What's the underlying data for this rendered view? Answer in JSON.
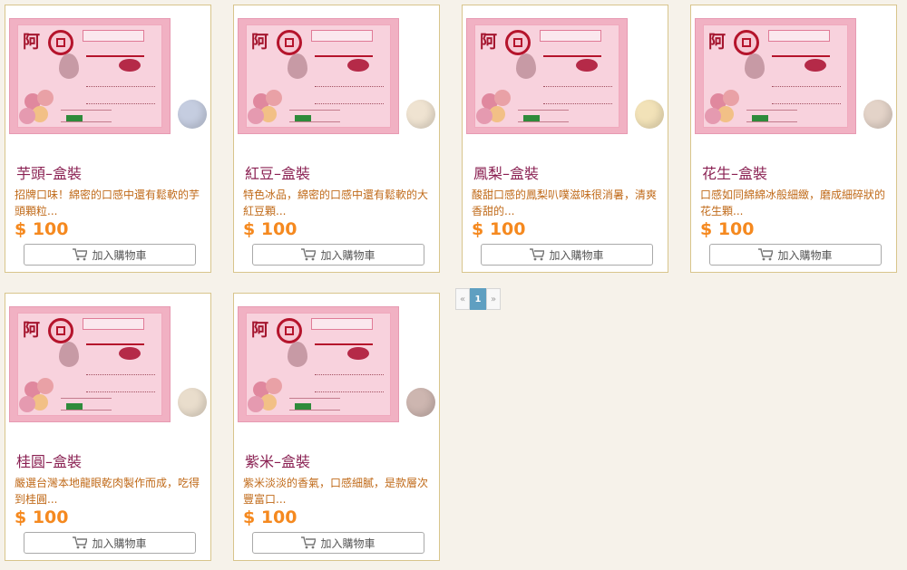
{
  "products": [
    {
      "title": "芋頭–盒裝",
      "desc": "招牌口味！綿密的口感中還有鬆軟的芋頭顆粒...",
      "price": "$ 100",
      "button": "加入購物車",
      "ball_color": "#c5cde0"
    },
    {
      "title": "紅豆–盒裝",
      "desc": "特色冰品，綿密的口感中還有鬆軟的大紅豆顆...",
      "price": "$ 100",
      "button": "加入購物車",
      "ball_color": "#efe3d1"
    },
    {
      "title": "鳳梨–盒裝",
      "desc": "酸甜口感的鳳梨叭噗滋味很消暑，清爽香甜的...",
      "price": "$ 100",
      "button": "加入購物車",
      "ball_color": "#f2e2b8"
    },
    {
      "title": "花生–盒裝",
      "desc": "口感如同綿綿冰般細緻，磨成細碎狀的花生顆...",
      "price": "$ 100",
      "button": "加入購物車",
      "ball_color": "#e3d3c8"
    },
    {
      "title": "桂圓–盒裝",
      "desc": "嚴選台灣本地龍眼乾肉製作而成，吃得到桂圓...",
      "price": "$ 100",
      "button": "加入購物車",
      "ball_color": "#e9ddcc"
    },
    {
      "title": "紫米–盒裝",
      "desc": "紫米淡淡的香氣，口感細膩，是款層次豐富口...",
      "price": "$ 100",
      "button": "加入購物車",
      "ball_color": "#cdb6b0"
    }
  ],
  "pagination": {
    "prev": "«",
    "current": "1",
    "next": "»"
  }
}
